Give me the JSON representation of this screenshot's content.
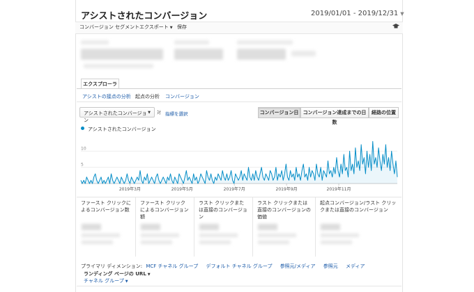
{
  "header": {
    "title": "アシストされたコンバージョン",
    "date_range": "2019/01/01 - 2019/12/31"
  },
  "toolbar": {
    "segment": "コンバージョン セグメント",
    "export": "エクスポート",
    "save": "保存"
  },
  "explorer": {
    "tab": "エクスプローラ",
    "subtabs": [
      "アシストの接点の分析",
      "起点の分析",
      "コンバージョン"
    ]
  },
  "controls": {
    "metric_select": "アシストされたコンバージョン",
    "vs": "対",
    "select_metric": "指標を選択",
    "view_buttons": [
      "コンバージョン日",
      "コンバージョン達成までの日数",
      "経路の位置"
    ]
  },
  "chart_data": {
    "type": "area",
    "series": [
      {
        "name": "アシストされたコンバージョン",
        "color": "#058dc7",
        "values": [
          1,
          0,
          1,
          0,
          2,
          1,
          0,
          1,
          0,
          2,
          3,
          1,
          0,
          1,
          2,
          0,
          1,
          0,
          1,
          2,
          0,
          3,
          1,
          0,
          1,
          2,
          1,
          0,
          2,
          1,
          0,
          1,
          3,
          1,
          0,
          2,
          1,
          0,
          1,
          2,
          1,
          4,
          1,
          0,
          2,
          1,
          3,
          0,
          1,
          2,
          1,
          0,
          2,
          3,
          1,
          0,
          1,
          2,
          1,
          0,
          2,
          1,
          3,
          1,
          0,
          2,
          1,
          0,
          3,
          2,
          1,
          0,
          2,
          4,
          1,
          2,
          1,
          0,
          3,
          1,
          2,
          0,
          1,
          3,
          2,
          1,
          0,
          4,
          2,
          1,
          3,
          1,
          0,
          2,
          1,
          3,
          2,
          1,
          4,
          2,
          1,
          3,
          1,
          2,
          4,
          1,
          0,
          3,
          2,
          1,
          2,
          4,
          1,
          3,
          2,
          1,
          5,
          2,
          1,
          3,
          1,
          4,
          2,
          1,
          3,
          5,
          2,
          1,
          3,
          2,
          1,
          4,
          3,
          1,
          2,
          5,
          1,
          3,
          2,
          4,
          1,
          3,
          6,
          2,
          1,
          4,
          2,
          3,
          1,
          5,
          2,
          3,
          1,
          4,
          6,
          2,
          3,
          1,
          5,
          2,
          4,
          3,
          1,
          6,
          3,
          2,
          5,
          1,
          4,
          3,
          2,
          7,
          3,
          4,
          2,
          5,
          3,
          8,
          4,
          2,
          6,
          3,
          9,
          4,
          5,
          2,
          10,
          4,
          6,
          3,
          11,
          5,
          7,
          4,
          12,
          6,
          8,
          3,
          10,
          5,
          9,
          4,
          13,
          6,
          8,
          5,
          11,
          7,
          4,
          9,
          6,
          12,
          5,
          8,
          4,
          10,
          6,
          3,
          7,
          2
        ]
      }
    ],
    "x_ticks": [
      "2019年3月",
      "2019年5月",
      "2019年7月",
      "2019年9月",
      "2019年11月"
    ],
    "y_ticks": [
      "10",
      "5"
    ],
    "ylim": [
      0,
      15
    ],
    "grid": true
  },
  "stats": [
    {
      "label": "ファースト クリックによるコンバージョン数"
    },
    {
      "label": "ファースト クリックによるコンバージョン額"
    },
    {
      "label": "ラスト クリックまたは直接のコンバージョン"
    },
    {
      "label": "ラスト クリックまたは直接のコンバージョンの価値"
    },
    {
      "label": "起点コンバージョン/ラスト クリックまたは直接のコンバージョン"
    }
  ],
  "dimensions": {
    "label": "プライマリ ディメンション:",
    "links": [
      "MCF チャネル グループ",
      "デフォルト チャネル グループ",
      "参照元/メディア",
      "参照元",
      "メディア"
    ],
    "more": "ランディング ページの URL",
    "channel_group": "チャネル グループ"
  }
}
